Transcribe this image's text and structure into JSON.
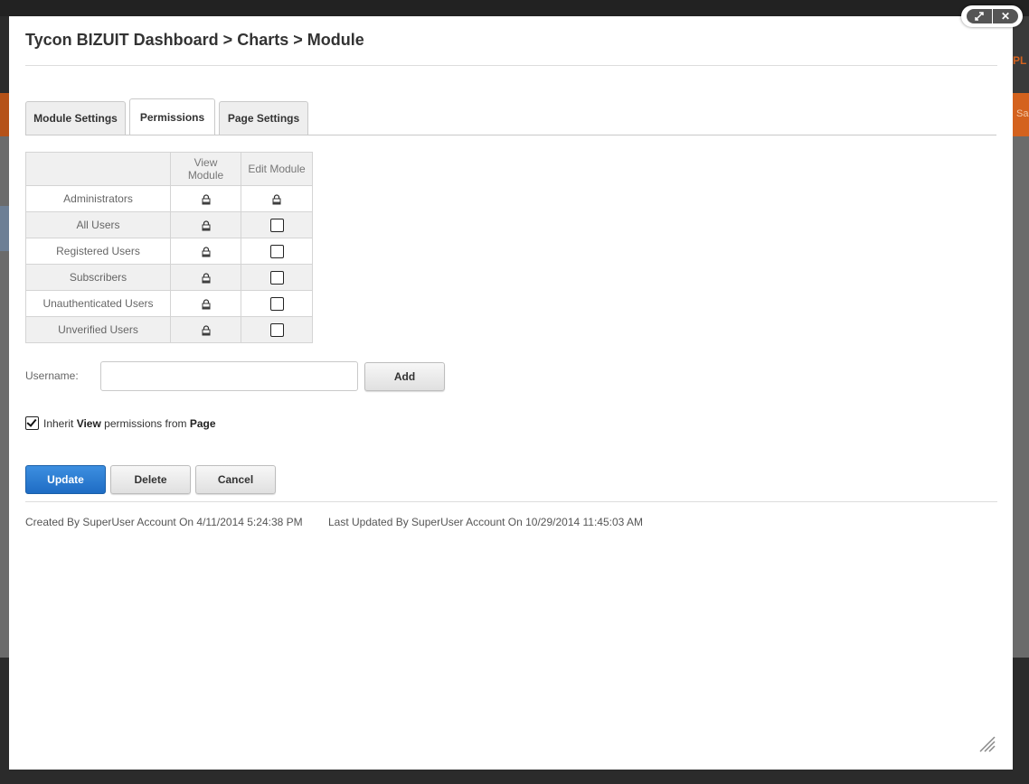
{
  "background": {
    "brand_fragment": "PL",
    "nav_fragment": "Sa"
  },
  "window_controls": {
    "maximize_icon": "expand-icon",
    "close_icon": "close-icon"
  },
  "header": {
    "title": "Tycon BIZUIT Dashboard > Charts > Module"
  },
  "tabs": [
    {
      "label": "Module Settings",
      "active": false
    },
    {
      "label": "Permissions",
      "active": true
    },
    {
      "label": "Page Settings",
      "active": false
    }
  ],
  "permissions": {
    "columns": [
      "View Module",
      "Edit Module"
    ],
    "rows": [
      {
        "role": "Administrators",
        "view": "locked",
        "edit": "locked"
      },
      {
        "role": "All Users",
        "view": "locked",
        "edit": "unchecked"
      },
      {
        "role": "Registered Users",
        "view": "locked",
        "edit": "unchecked"
      },
      {
        "role": "Subscribers",
        "view": "locked",
        "edit": "unchecked"
      },
      {
        "role": "Unauthenticated Users",
        "view": "locked",
        "edit": "unchecked"
      },
      {
        "role": "Unverified Users",
        "view": "locked",
        "edit": "unchecked"
      }
    ]
  },
  "username": {
    "label": "Username:",
    "value": "",
    "add_label": "Add"
  },
  "inherit": {
    "checked": true,
    "text_pre": "Inherit ",
    "text_view": "View",
    "text_mid": " permissions from ",
    "text_page": "Page"
  },
  "actions": {
    "update": "Update",
    "delete": "Delete",
    "cancel": "Cancel"
  },
  "meta": {
    "created": "Created By SuperUser Account On 4/11/2014 5:24:38 PM",
    "updated": "Last Updated By SuperUser Account On 10/29/2014 11:45:03 AM"
  },
  "colors": {
    "accent_blue": "#1f6cc4",
    "orange": "#d4621e"
  }
}
